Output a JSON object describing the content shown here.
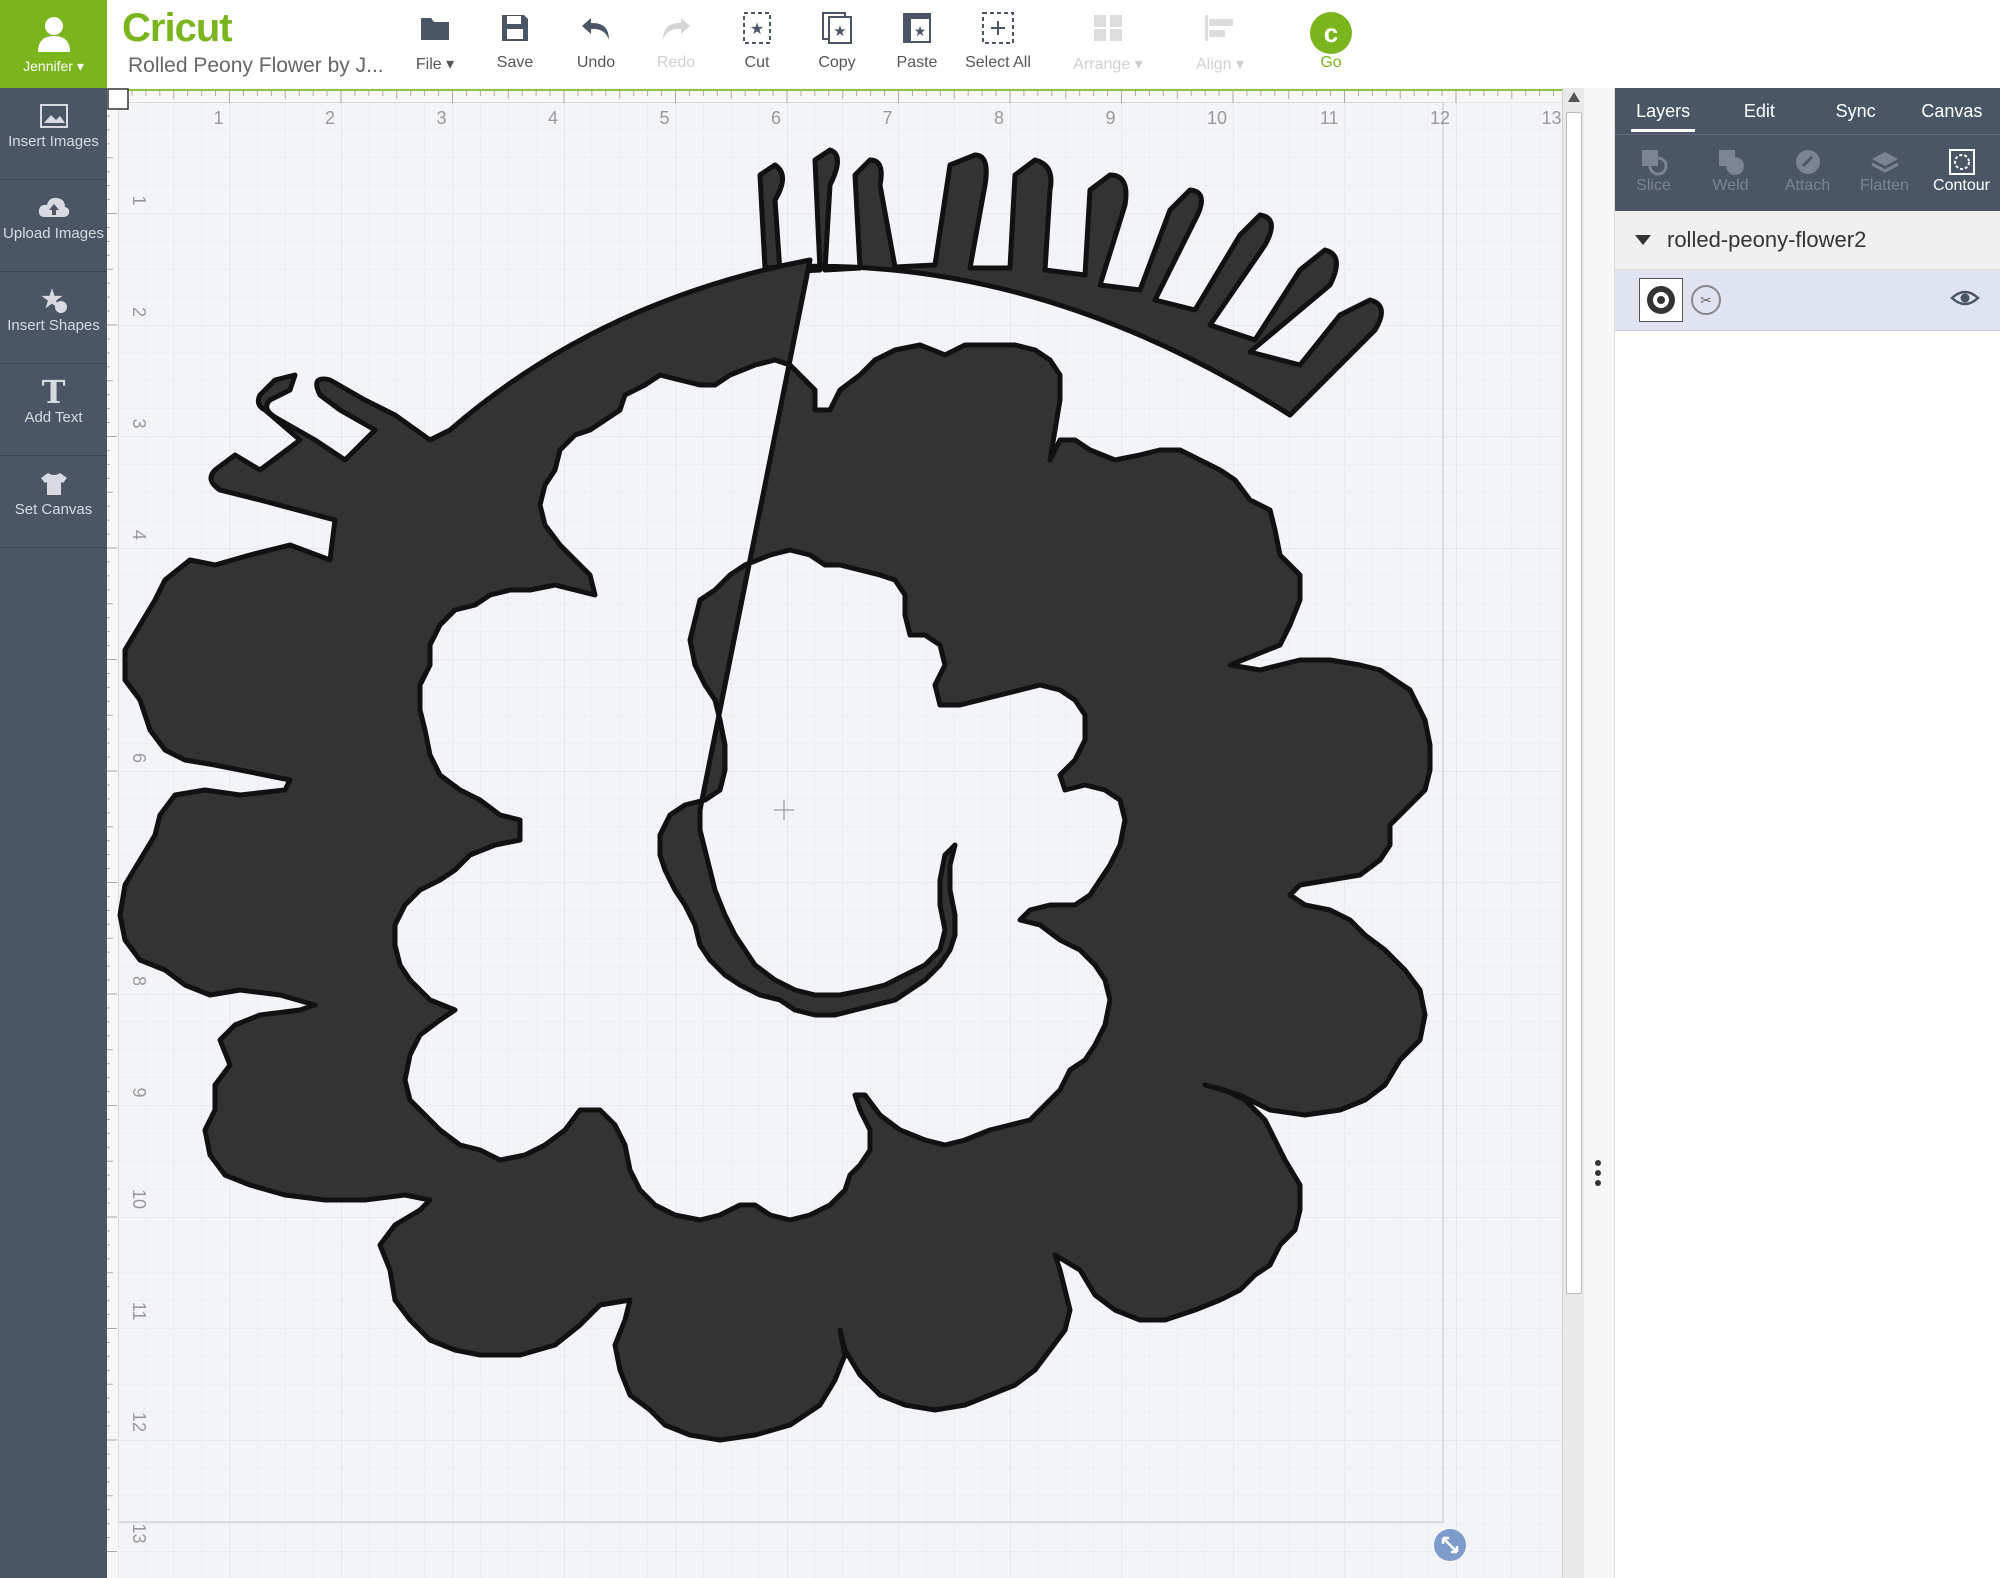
{
  "user": {
    "name": "Jennifer"
  },
  "brand": "Cricut",
  "document_title": "Rolled Peony Flower by J...",
  "toolbar": {
    "file": "File",
    "save": "Save",
    "undo": "Undo",
    "redo": "Redo",
    "cut": "Cut",
    "copy": "Copy",
    "paste": "Paste",
    "select_all": "Select All",
    "arrange": "Arrange",
    "align": "Align",
    "go": "Go",
    "go_symbol": "c"
  },
  "leftnav": {
    "insert_images": "Insert Images",
    "upload_images": "Upload Images",
    "insert_shapes": "Insert Shapes",
    "add_text": "Add Text",
    "add_text_glyph": "T",
    "set_canvas": "Set Canvas"
  },
  "ruler": {
    "top": [
      "1",
      "2",
      "3",
      "4",
      "5",
      "6",
      "7",
      "8",
      "9",
      "10",
      "11",
      "12",
      "13"
    ],
    "left": [
      "1",
      "2",
      "3",
      "4",
      "5",
      "6",
      "7",
      "8",
      "9",
      "10",
      "11",
      "12",
      "13"
    ]
  },
  "panel": {
    "tabs": [
      "Layers",
      "Edit",
      "Sync",
      "Canvas"
    ],
    "active_tab": "Layers",
    "tools": [
      "Slice",
      "Weld",
      "Attach",
      "Flatten",
      "Contour"
    ],
    "active_tool": "Contour",
    "layer_group_name": "rolled-peony-flower2"
  },
  "colors": {
    "accent": "#7ab51d",
    "nav_bg": "#4a5566",
    "shape_fill": "#333333",
    "canvas_bg": "#f2f4f7"
  }
}
